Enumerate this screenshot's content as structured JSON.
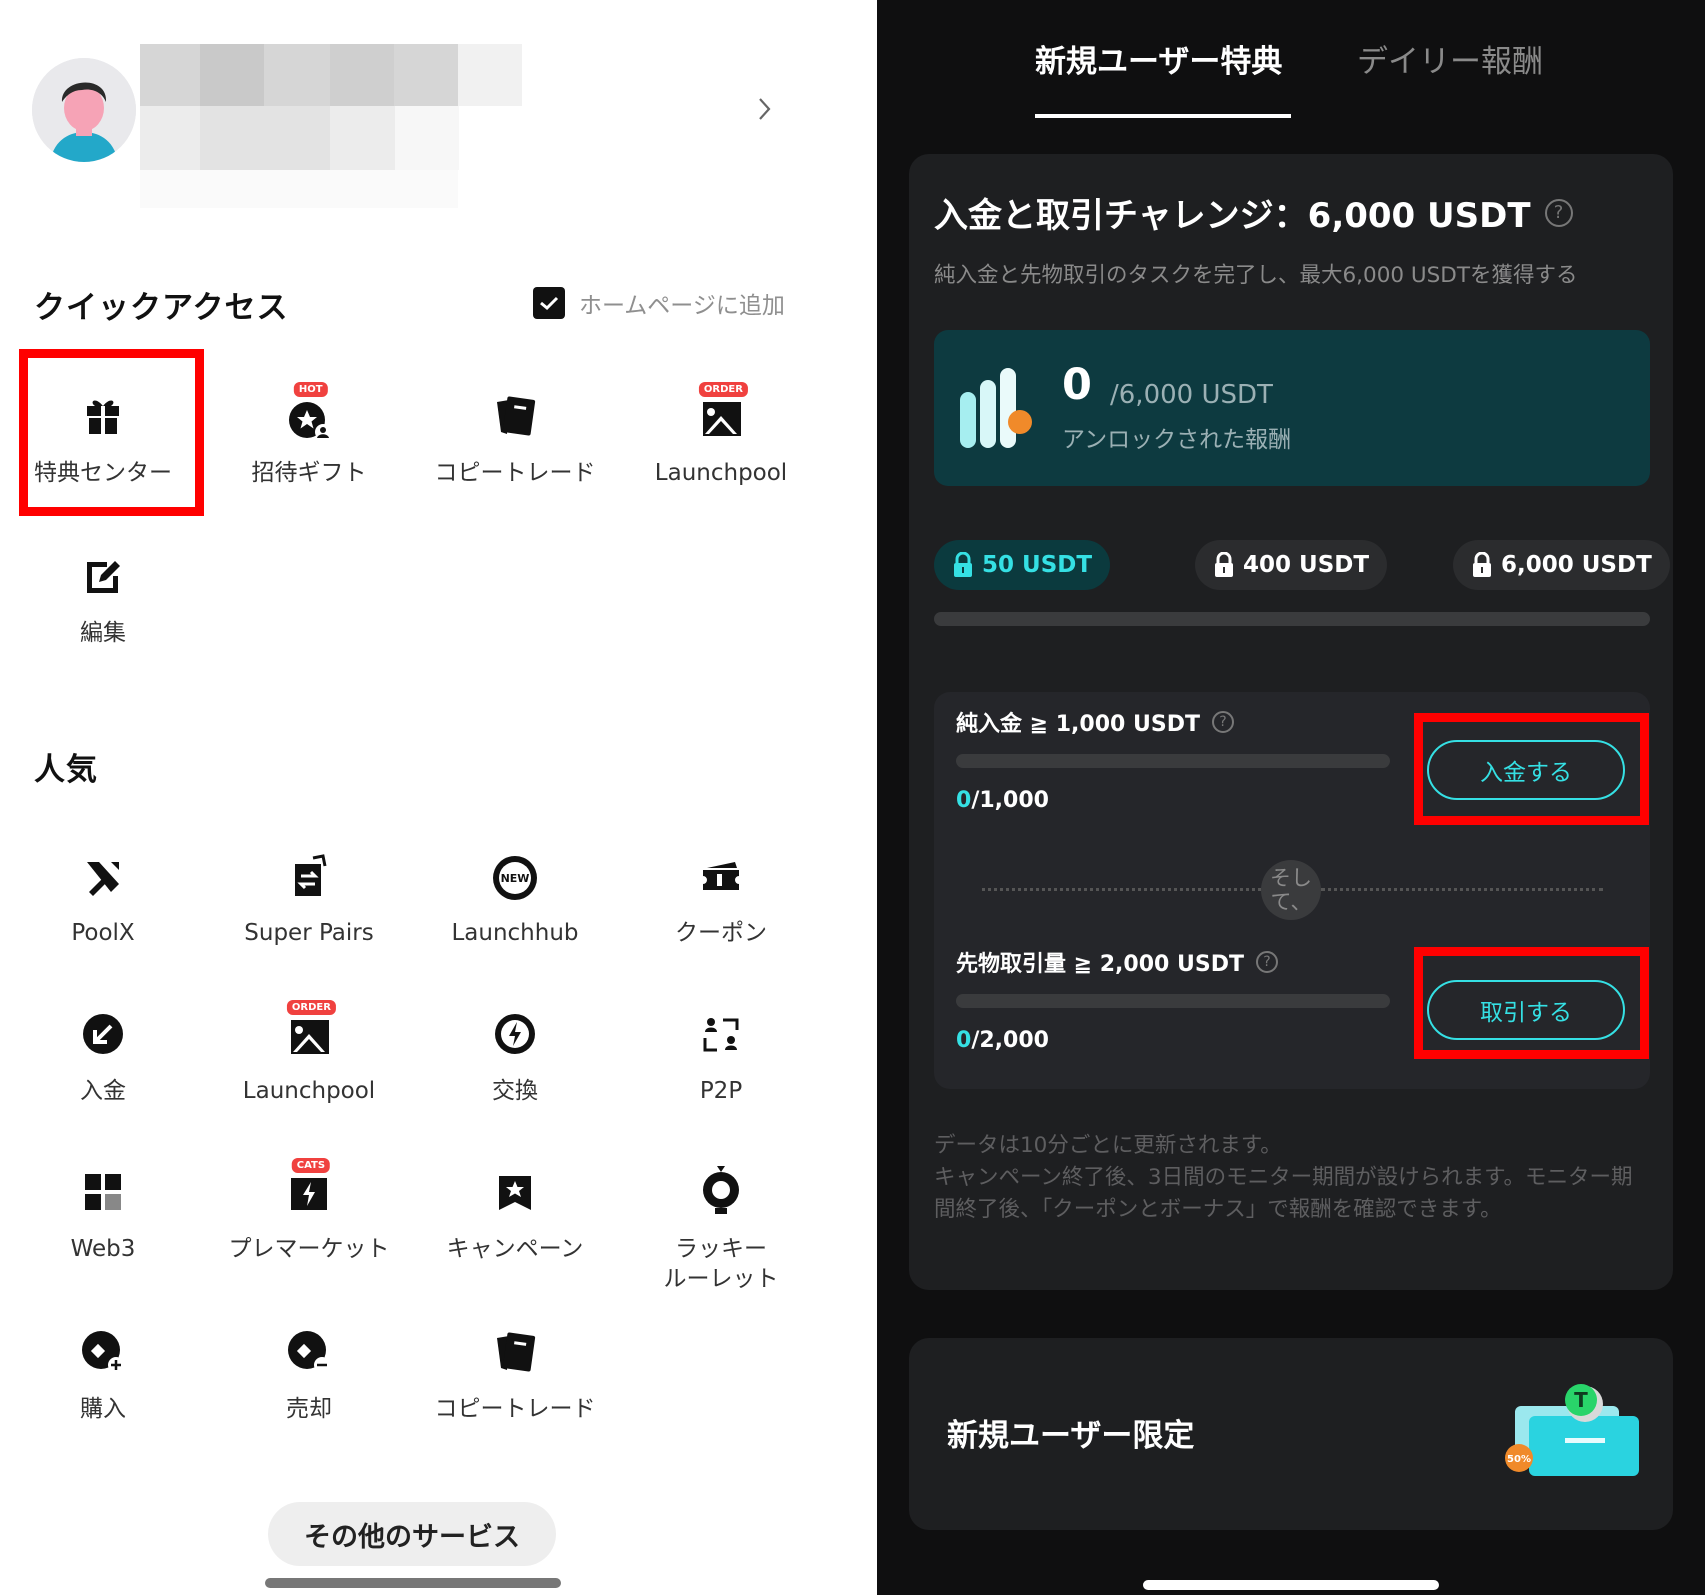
{
  "quick_access": {
    "title": "クイックアクセス",
    "add_to_home_label": "ホームページに追加",
    "items": [
      {
        "label": "特典センター",
        "icon": "gift-icon"
      },
      {
        "label": "招待ギフト",
        "icon": "invite-gift-icon",
        "badge": "HOT"
      },
      {
        "label": "コピートレード",
        "icon": "copy-trade-icon"
      },
      {
        "label": "Launchpool",
        "icon": "launchpool-icon",
        "badge": "ORDER"
      },
      {
        "label": "編集",
        "icon": "edit-icon"
      }
    ]
  },
  "popular": {
    "title": "人気",
    "items": [
      {
        "label": "PoolX",
        "icon": "poolx-icon"
      },
      {
        "label": "Super Pairs",
        "icon": "super-pairs-icon"
      },
      {
        "label": "Launchhub",
        "icon": "launchhub-icon",
        "badge": "NEW"
      },
      {
        "label": "クーポン",
        "icon": "coupon-icon"
      },
      {
        "label": "入金",
        "icon": "deposit-icon"
      },
      {
        "label": "Launchpool",
        "icon": "launchpool-icon",
        "badge": "ORDER"
      },
      {
        "label": "交換",
        "icon": "swap-icon"
      },
      {
        "label": "P2P",
        "icon": "p2p-icon"
      },
      {
        "label": "Web3",
        "icon": "web3-icon"
      },
      {
        "label": "プレマーケット",
        "icon": "premarket-icon",
        "badge": "CATS"
      },
      {
        "label": "キャンペーン",
        "icon": "campaign-icon"
      },
      {
        "label": "ラッキー\nルーレット",
        "icon": "lucky-roulette-icon"
      },
      {
        "label": "購入",
        "icon": "buy-icon"
      },
      {
        "label": "売却",
        "icon": "sell-icon"
      },
      {
        "label": "コピートレード",
        "icon": "copy-trade-icon"
      }
    ]
  },
  "more_services_label": "その他のサービス",
  "right": {
    "tabs": [
      {
        "label": "新規ユーザー特典",
        "active": true
      },
      {
        "label": "デイリー報酬",
        "active": false
      }
    ],
    "challenge": {
      "title": "入金と取引チャレンジ：6,000 USDT",
      "subtitle": "純入金と先物取引のタスクを完了し、最大6,000 USDTを獲得する",
      "unlocked_value": "0",
      "total_label": "/6,000 USDT",
      "unlocked_label": "アンロックされた報酬",
      "tiers": [
        "50 USDT",
        "400 USDT",
        "6,000 USDT"
      ],
      "tier_progress": 0,
      "tasks": [
        {
          "title": "純入金 ≧ 1,000 USDT",
          "current": "0",
          "target": "/1,000",
          "progress": 0,
          "button": "入金する"
        },
        {
          "title": "先物取引量 ≧ 2,000 USDT",
          "current": "0",
          "target": "/2,000",
          "progress": 0,
          "button": "取引する"
        }
      ],
      "and_label": "そし\nて、",
      "note": "データは10分ごとに更新されます。\nキャンペーン終了後、3日間のモニター期間が設けられます。モニター期間終了後、「クーポンとボーナス」で報酬を確認できます。"
    },
    "promo": {
      "title": "新規ユーザー限定",
      "badge": "50%"
    }
  },
  "colors": {
    "accent": "#35e0e4",
    "highlight_frame": "#ff0000",
    "dark_bg": "#0f0f10",
    "card_bg": "#1e1f21"
  }
}
